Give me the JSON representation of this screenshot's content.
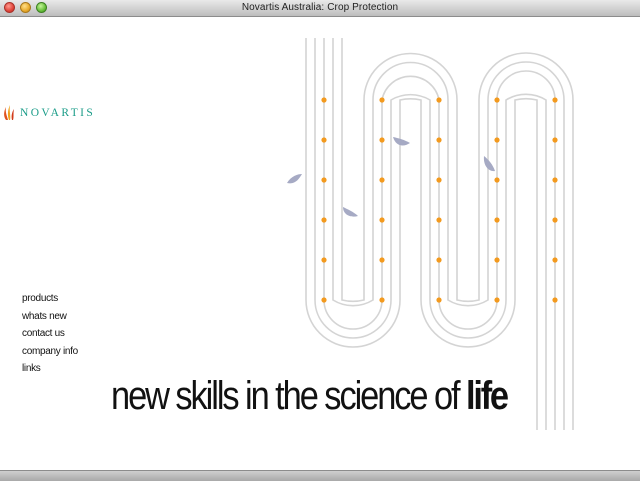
{
  "window": {
    "title": "Novartis Australia: Crop Protection"
  },
  "brand": {
    "logo_text": "NOVARTIS",
    "teal": "#1a9c88",
    "orange": "#f39a1e",
    "leaf": "#a6aac4"
  },
  "nav": {
    "items": [
      {
        "label": "products"
      },
      {
        "label": "whats new"
      },
      {
        "label": "contact us"
      },
      {
        "label": "company info"
      },
      {
        "label": "links"
      }
    ]
  },
  "slogan": {
    "text": "new skills in the science of ",
    "emphasis": "life"
  }
}
